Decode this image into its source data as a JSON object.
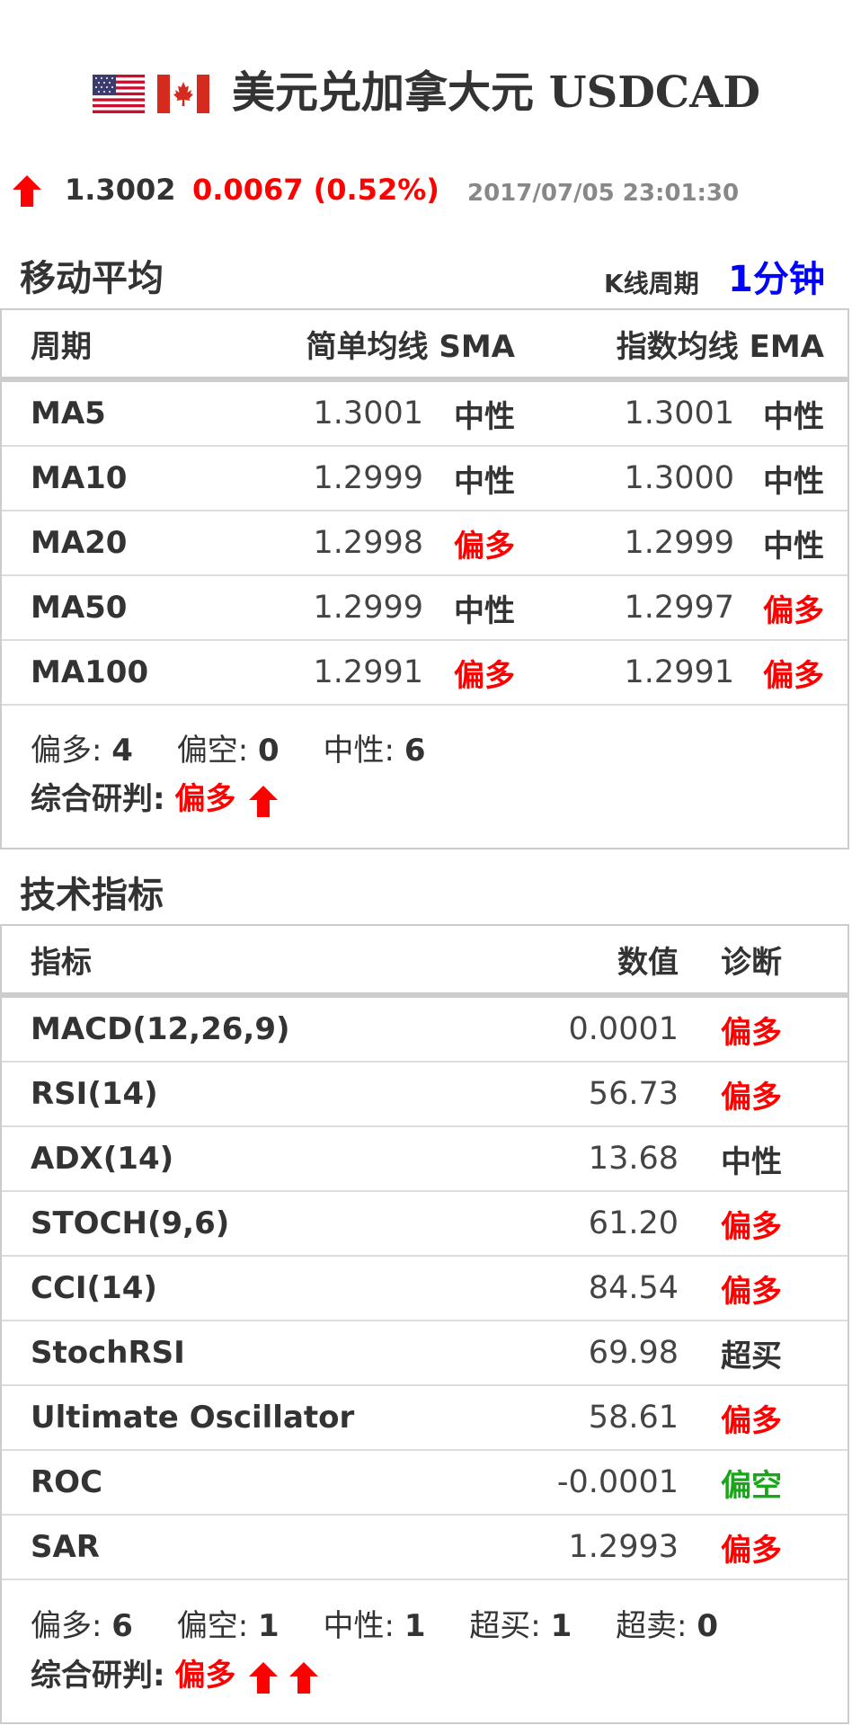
{
  "header": {
    "title_cn": "美元兑加拿大元",
    "title_en": "USDCAD",
    "flags": [
      "us-flag-icon",
      "ca-flag-icon"
    ]
  },
  "quote": {
    "direction_icon": "arrow-up-icon",
    "price": "1.3002",
    "change": "0.0067 (0.52%)",
    "timestamp": "2017/07/05 23:01:30"
  },
  "ma": {
    "section_title": "移动平均",
    "period_label": "K线周期",
    "period_value": "1分钟",
    "columns": [
      "周期",
      "简单均线 SMA",
      "指数均线 EMA"
    ],
    "rows": [
      {
        "name": "MA5",
        "sma": "1.3001",
        "sma_sig": "中性",
        "ema": "1.3001",
        "ema_sig": "中性"
      },
      {
        "name": "MA10",
        "sma": "1.2999",
        "sma_sig": "中性",
        "ema": "1.3000",
        "ema_sig": "中性"
      },
      {
        "name": "MA20",
        "sma": "1.2998",
        "sma_sig": "偏多",
        "ema": "1.2999",
        "ema_sig": "中性"
      },
      {
        "name": "MA50",
        "sma": "1.2999",
        "sma_sig": "中性",
        "ema": "1.2997",
        "ema_sig": "偏多"
      },
      {
        "name": "MA100",
        "sma": "1.2991",
        "sma_sig": "偏多",
        "ema": "1.2991",
        "ema_sig": "偏多"
      }
    ],
    "summary": {
      "bull_label": "偏多:",
      "bull": "4",
      "bear_label": "偏空:",
      "bear": "0",
      "neutral_label": "中性:",
      "neutral": "6",
      "verdict_label": "综合研判:",
      "verdict": "偏多"
    }
  },
  "tech": {
    "section_title": "技术指标",
    "columns": [
      "指标",
      "数值",
      "诊断"
    ],
    "rows": [
      {
        "name": "MACD(12,26,9)",
        "value": "0.0001",
        "signal": "偏多"
      },
      {
        "name": "RSI(14)",
        "value": "56.73",
        "signal": "偏多"
      },
      {
        "name": "ADX(14)",
        "value": "13.68",
        "signal": "中性"
      },
      {
        "name": "STOCH(9,6)",
        "value": "61.20",
        "signal": "偏多"
      },
      {
        "name": "CCI(14)",
        "value": "84.54",
        "signal": "偏多"
      },
      {
        "name": "StochRSI",
        "value": "69.98",
        "signal": "超买"
      },
      {
        "name": "Ultimate Oscillator",
        "value": "58.61",
        "signal": "偏多"
      },
      {
        "name": "ROC",
        "value": "-0.0001",
        "signal": "偏空"
      },
      {
        "name": "SAR",
        "value": "1.2993",
        "signal": "偏多"
      }
    ],
    "summary": {
      "bull_label": "偏多:",
      "bull": "6",
      "bear_label": "偏空:",
      "bear": "1",
      "neutral_label": "中性:",
      "neutral": "1",
      "overbought_label": "超买:",
      "overbought": "1",
      "oversold_label": "超卖:",
      "oversold": "0",
      "verdict_label": "综合研判:",
      "verdict": "偏多"
    }
  },
  "colors": {
    "bullish": "#ff0000",
    "bearish": "#1aa51a",
    "neutral": "#333333",
    "period_accent": "#0000ff"
  }
}
